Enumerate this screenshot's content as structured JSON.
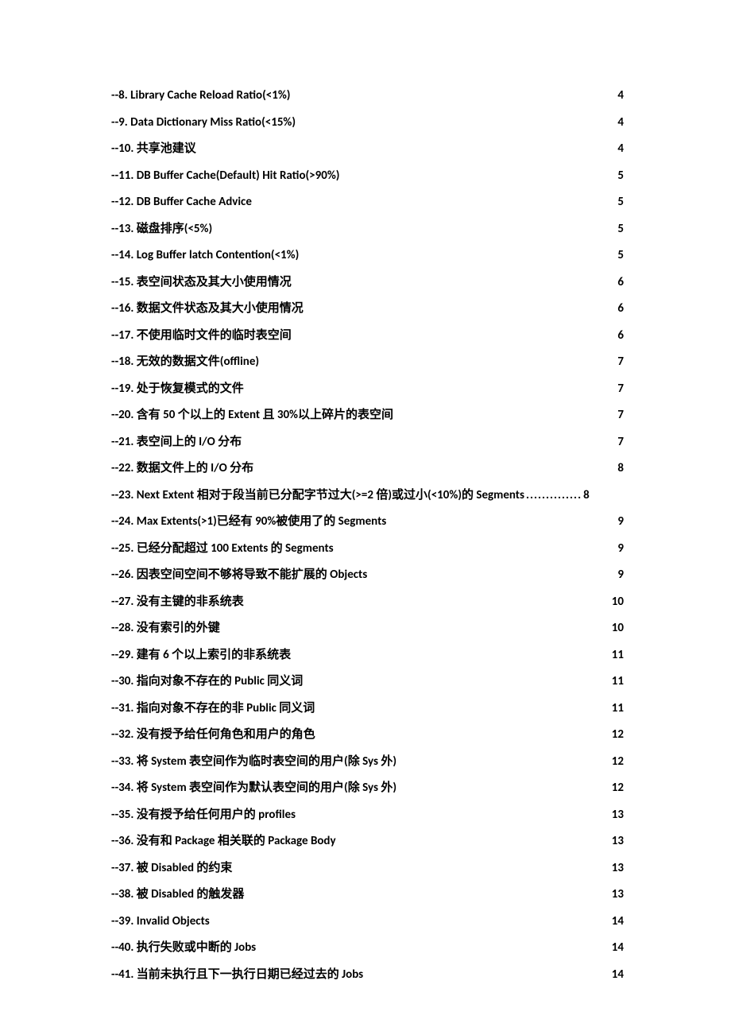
{
  "toc": [
    {
      "label": "--8. Library Cache Reload Ratio(<1%)",
      "page": "4",
      "leader": true
    },
    {
      "label": "--9. Data Dictionary Miss Ratio(<15%)",
      "page": "4",
      "leader": true
    },
    {
      "label": "--10. 共享池建议",
      "page": "4",
      "leader": true
    },
    {
      "label": "--11. DB Buffer Cache(Default) Hit Ratio(>90%)",
      "page": "5",
      "leader": true
    },
    {
      "label": "--12. DB Buffer Cache Advice",
      "page": "5",
      "leader": true
    },
    {
      "label": "--13. 磁盘排序(<5%)",
      "page": "5",
      "leader": true
    },
    {
      "label": "--14. Log Buffer latch Contention(<1%)",
      "page": "5",
      "leader": true
    },
    {
      "label": "--15. 表空间状态及其大小使用情况",
      "page": "6",
      "leader": true
    },
    {
      "label": "--16. 数据文件状态及其大小使用情况",
      "page": "6",
      "leader": true
    },
    {
      "label": "--17. 不使用临时文件的临时表空间",
      "page": "6",
      "leader": true
    },
    {
      "label": "--18. 无效的数据文件(offline)",
      "page": "7",
      "leader": true
    },
    {
      "label": "--19. 处于恢复模式的文件",
      "page": "7",
      "leader": true
    },
    {
      "label": "--20. 含有 50 个以上的 Extent 且 30%以上碎片的表空间",
      "page": "7",
      "leader": true
    },
    {
      "label": "--21. 表空间上的 I/O 分布",
      "page": "7",
      "leader": true
    },
    {
      "label": "--22. 数据文件上的 I/O 分布",
      "page": "8",
      "leader": true
    },
    {
      "label": "--23. Next Extent 相对于段当前已分配字节过大(>=2 倍)或过小(<10%)的 Segments",
      "page": "8",
      "leader": false
    },
    {
      "label": "--24. Max Extents(>1)已经有 90%被使用了的 Segments",
      "page": "9",
      "leader": true
    },
    {
      "label": "--25. 已经分配超过 100 Extents 的 Segments",
      "page": "9",
      "leader": true
    },
    {
      "label": "--26. 因表空间空间不够将导致不能扩展的 Objects",
      "page": "9",
      "leader": true
    },
    {
      "label": "--27. 没有主键的非系统表",
      "page": "10",
      "leader": true
    },
    {
      "label": "--28. 没有索引的外键",
      "page": "10",
      "leader": true
    },
    {
      "label": "--29. 建有 6 个以上索引的非系统表",
      "page": "11",
      "leader": true
    },
    {
      "label": "--30. 指向对象不存在的 Public 同义词",
      "page": "11",
      "leader": true
    },
    {
      "label": "--31. 指向对象不存在的非 Public 同义词",
      "page": "11",
      "leader": true
    },
    {
      "label": "--32. 没有授予给任何角色和用户的角色",
      "page": "12",
      "leader": true
    },
    {
      "label": "--33. 将 System 表空间作为临时表空间的用户(除 Sys 外)",
      "page": "12",
      "leader": true
    },
    {
      "label": "--34. 将 System 表空间作为默认表空间的用户(除 Sys 外)",
      "page": "12",
      "leader": true
    },
    {
      "label": "--35. 没有授予给任何用户的 profiles",
      "page": "13",
      "leader": true
    },
    {
      "label": "--36. 没有和 Package 相关联的 Package Body",
      "page": "13",
      "leader": true
    },
    {
      "label": "--37. 被 Disabled 的约束",
      "page": "13",
      "leader": true
    },
    {
      "label": "--38. 被 Disabled 的触发器",
      "page": "13",
      "leader": true
    },
    {
      "label": "--39. Invalid Objects",
      "page": "14",
      "leader": true
    },
    {
      "label": "--40. 执行失败或中断的 Jobs",
      "page": "14",
      "leader": true
    },
    {
      "label": "--41. 当前未执行且下一执行日期已经过去的 Jobs",
      "page": "14",
      "leader": true
    }
  ]
}
